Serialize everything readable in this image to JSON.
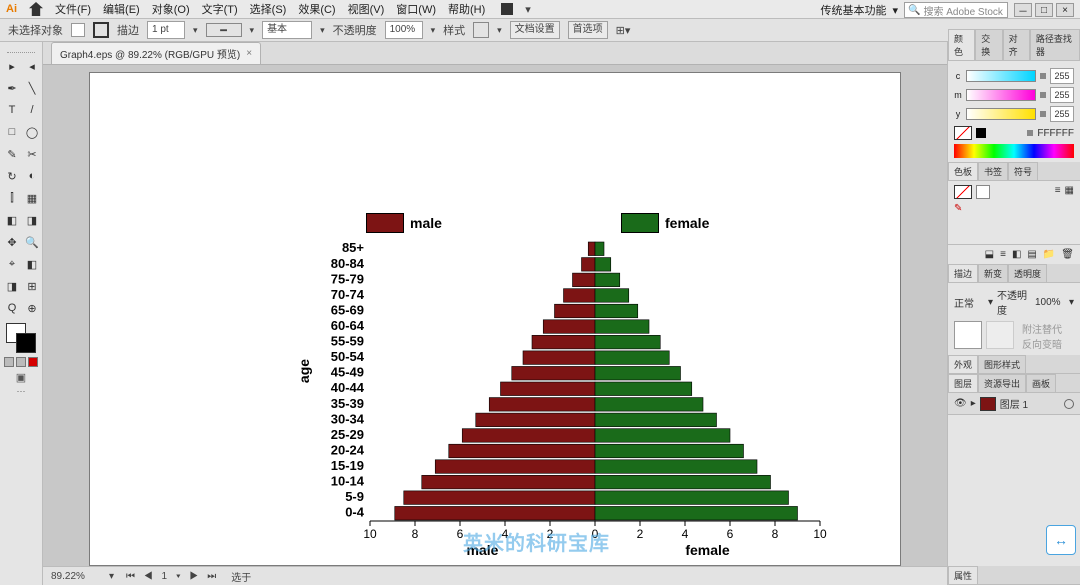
{
  "menus": [
    "文件(F)",
    "编辑(E)",
    "对象(O)",
    "文字(T)",
    "选择(S)",
    "效果(C)",
    "视图(V)",
    "窗口(W)",
    "帮助(H)"
  ],
  "workspace_label": "传统基本功能",
  "search_placeholder": "搜索 Adobe Stock",
  "toolbar": {
    "no_selection": "未选择对象",
    "stroke_label": "描边",
    "stroke_val": "1 pt",
    "uniform": "基本",
    "opacity_label": "不透明度",
    "opacity_val": "100%",
    "style_label": "样式",
    "doc_setup": "文档设置",
    "prefs": "首选项"
  },
  "file_tab": "Graph4.eps @ 89.22% (RGB/GPU 预览)",
  "status": {
    "zoom": "89.22%",
    "hint": "选于"
  },
  "panels": {
    "color_tabs": [
      "颜色",
      "交换",
      "对齐",
      "路径查找器"
    ],
    "cmy": [
      {
        "k": "c",
        "v": "255"
      },
      {
        "k": "m",
        "v": "255"
      },
      {
        "k": "y",
        "v": "255"
      }
    ],
    "hex": "FFFFFF",
    "second_tabs": [
      "色板",
      "书签",
      "符号"
    ],
    "link_tabs": [
      "描边",
      "新变",
      "透明度"
    ],
    "normal": "正常",
    "opacity_label": "不透明度",
    "opacity_val": "100%",
    "opt1": "附注替代",
    "opt2": "反向变暗",
    "appearance_tabs": [
      "外观",
      "图形样式"
    ],
    "layer_tabs": [
      "图层",
      "资源导出",
      "画板"
    ],
    "layer_name": "图层 1",
    "property_tabs": [
      "属性"
    ]
  },
  "colors": {
    "male": "#7d1414",
    "female": "#1a6b1a"
  },
  "chart_data": {
    "type": "bar",
    "title": "",
    "ylabel": "age",
    "xlabel_left": "male",
    "xlabel_right": "female",
    "categories": [
      "85+",
      "80-84",
      "75-79",
      "70-74",
      "65-69",
      "60-64",
      "55-59",
      "50-54",
      "45-49",
      "40-44",
      "35-39",
      "30-34",
      "25-29",
      "20-24",
      "15-19",
      "10-14",
      "5-9",
      "0-4"
    ],
    "series": [
      {
        "name": "male",
        "values": [
          0.3,
          0.6,
          1.0,
          1.4,
          1.8,
          2.3,
          2.8,
          3.2,
          3.7,
          4.2,
          4.7,
          5.3,
          5.9,
          6.5,
          7.1,
          7.7,
          8.5,
          8.9
        ]
      },
      {
        "name": "female",
        "values": [
          0.4,
          0.7,
          1.1,
          1.5,
          1.9,
          2.4,
          2.9,
          3.3,
          3.8,
          4.3,
          4.8,
          5.4,
          6.0,
          6.6,
          7.2,
          7.8,
          8.6,
          9.0
        ]
      }
    ],
    "x_ticks": [
      0,
      2,
      4,
      6,
      8,
      10
    ]
  },
  "watermark": "英米的科研宝库"
}
